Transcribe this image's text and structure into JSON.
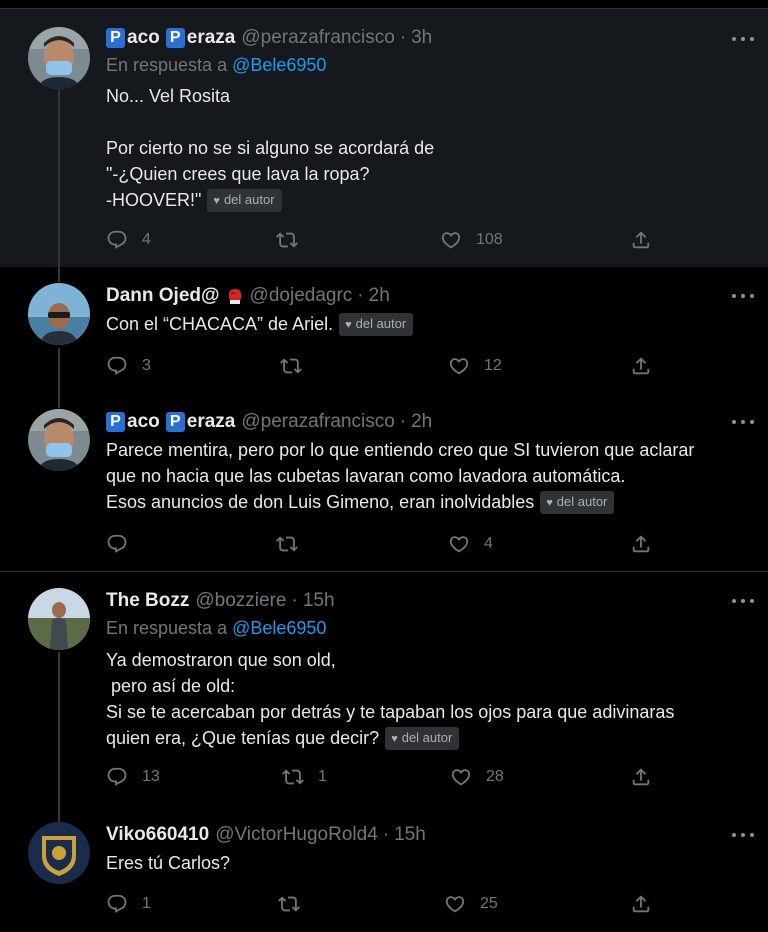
{
  "badge_label": "del autor",
  "tweets": [
    {
      "name_prefix": "P",
      "name_part1": "aco",
      "name_part2_prefix": "P",
      "name_part2": "eraza",
      "handle": "@perazafrancisco",
      "dot": "·",
      "time": "3h",
      "reply_prefix": "En respuesta a",
      "reply_to": "@Bele6950",
      "lines": [
        "No... Vel Rosita",
        "",
        "Por cierto no se si alguno se acordará de",
        "\"-¿Quien crees que lava la ropa?",
        "-HOOVER!\""
      ],
      "actions": {
        "reply": "4",
        "retweet": "",
        "like": "108"
      }
    },
    {
      "name": "Dann Ojed@",
      "handle": "@dojedagrc",
      "dot": "·",
      "time": "2h",
      "lines": [
        "Con el “CHACACA” de Ariel."
      ],
      "actions": {
        "reply": "3",
        "retweet": "",
        "like": "12"
      }
    },
    {
      "name_prefix": "P",
      "name_part1": "aco",
      "name_part2_prefix": "P",
      "name_part2": "eraza",
      "handle": "@perazafrancisco",
      "dot": "·",
      "time": "2h",
      "lines": [
        "Parece mentira, pero por lo que entiendo creo que SI tuvieron que aclarar",
        "que no hacia que las cubetas lavaran como lavadora automática.",
        "Esos anuncios de don Luis Gimeno, eran inolvidables"
      ],
      "actions": {
        "reply": "",
        "retweet": "",
        "like": "4"
      }
    },
    {
      "name": "The Bozz",
      "handle": "@bozziere",
      "dot": "·",
      "time": "15h",
      "reply_prefix": "En respuesta a",
      "reply_to": "@Bele6950",
      "lines": [
        "Ya demostraron que son old,",
        " pero así de old:",
        "Si se te acercaban por detrás y te tapaban los ojos para que adivinaras",
        "quien era, ¿Que tenías que decir?"
      ],
      "actions": {
        "reply": "13",
        "retweet": "1",
        "like": "28"
      }
    },
    {
      "name": "Viko660410",
      "handle": "@VictorHugoRold4",
      "dot": "·",
      "time": "15h",
      "lines": [
        "Eres tú Carlos?"
      ],
      "actions": {
        "reply": "1",
        "retweet": "",
        "like": "25"
      }
    }
  ]
}
